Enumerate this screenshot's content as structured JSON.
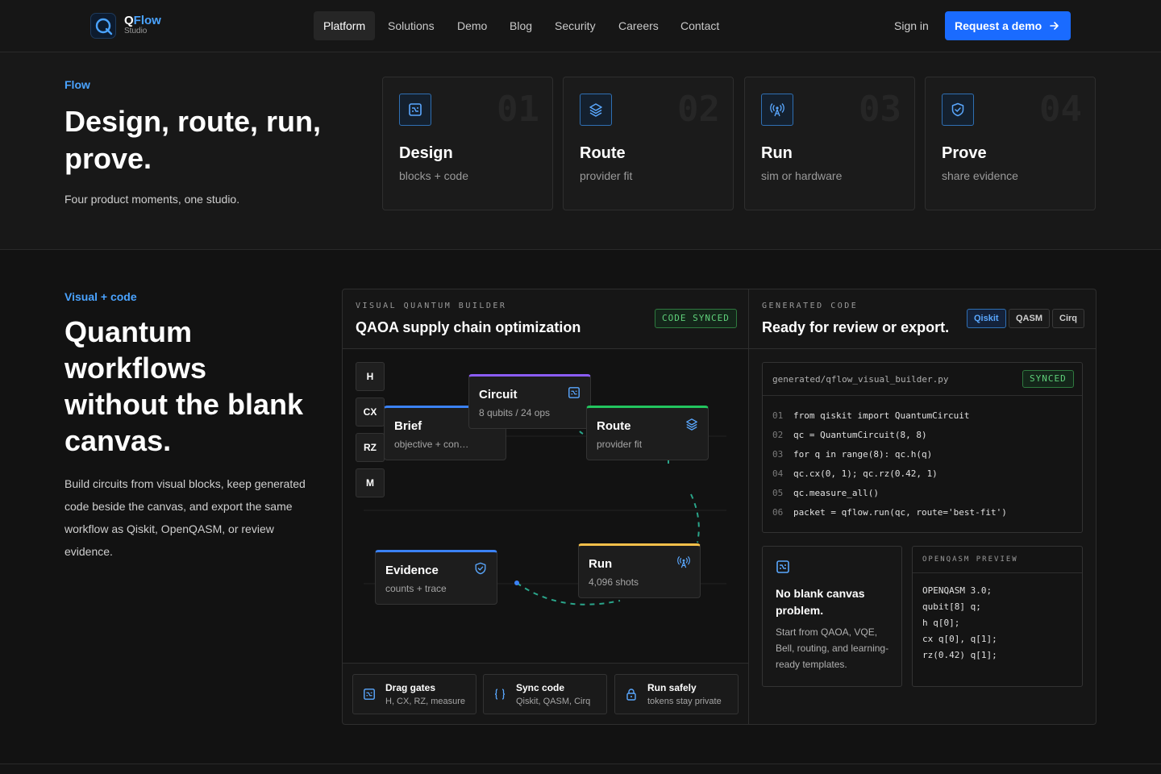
{
  "brand": {
    "name_a": "Q",
    "name_b": "Flow",
    "sub": "Studio"
  },
  "nav": {
    "items": [
      {
        "label": "Platform",
        "active": true
      },
      {
        "label": "Solutions"
      },
      {
        "label": "Demo"
      },
      {
        "label": "Blog"
      },
      {
        "label": "Security"
      },
      {
        "label": "Careers"
      },
      {
        "label": "Contact"
      }
    ],
    "signin": "Sign in",
    "cta": "Request a demo"
  },
  "flow": {
    "eyebrow": "Flow",
    "title_l1": "Design, route, run,",
    "title_l2": "prove.",
    "lead": "Four product moments, one studio.",
    "steps": [
      {
        "num": "01",
        "title": "Design",
        "sub": "blocks + code",
        "icon": "circuit-icon"
      },
      {
        "num": "02",
        "title": "Route",
        "sub": "provider fit",
        "icon": "layers-icon"
      },
      {
        "num": "03",
        "title": "Run",
        "sub": "sim or hardware",
        "icon": "antenna-icon"
      },
      {
        "num": "04",
        "title": "Prove",
        "sub": "share evidence",
        "icon": "shield-icon"
      }
    ]
  },
  "visual": {
    "eyebrow": "Visual + code",
    "title_l1": "Quantum",
    "title_l2": "workflows",
    "title_l3": "without the blank",
    "title_l4": "canvas.",
    "body": "Build circuits from visual blocks, keep generated code beside the canvas, and export the same workflow as Qiskit, OpenQASM, or review evidence."
  },
  "builder": {
    "eyebrow": "VISUAL QUANTUM BUILDER",
    "title": "QAOA supply chain optimization",
    "badge": "CODE SYNCED",
    "gates": [
      "H",
      "CX",
      "RZ",
      "M"
    ],
    "nodes": {
      "brief": {
        "title": "Brief",
        "sub": "objective + con…"
      },
      "circuit": {
        "title": "Circuit",
        "sub": "8 qubits / 24 ops"
      },
      "route": {
        "title": "Route",
        "sub": "provider fit"
      },
      "evidence": {
        "title": "Evidence",
        "sub": "counts + trace"
      },
      "run": {
        "title": "Run",
        "sub": "4,096 shots"
      }
    },
    "features": [
      {
        "title": "Drag gates",
        "sub": "H, CX, RZ, measure"
      },
      {
        "title": "Sync code",
        "sub": "Qiskit, QASM, Cirq"
      },
      {
        "title": "Run safely",
        "sub": "tokens stay private"
      }
    ]
  },
  "code": {
    "eyebrow": "GENERATED CODE",
    "title": "Ready for review or export.",
    "tabs": [
      "Qiskit",
      "QASM",
      "Cirq"
    ],
    "active_tab": "Qiskit",
    "file": "generated/qflow_visual_builder.py",
    "badge": "SYNCED",
    "lines": [
      {
        "n": "01",
        "t": "from qiskit import QuantumCircuit"
      },
      {
        "n": "02",
        "t": "qc = QuantumCircuit(8, 8)"
      },
      {
        "n": "03",
        "t": "for q in range(8): qc.h(q)"
      },
      {
        "n": "04",
        "t": "qc.cx(0, 1); qc.rz(0.42, 1)"
      },
      {
        "n": "05",
        "t": "qc.measure_all()"
      },
      {
        "n": "06",
        "t": "packet = qflow.run(qc, route='best-fit')"
      }
    ],
    "nb_title": "No blank canvas problem.",
    "nb_text": "Start from QAOA, VQE, Bell, routing, and learning-ready templates.",
    "qasm_head": "OPENQASM PREVIEW",
    "qasm_lines": [
      "OPENQASM 3.0;",
      "qubit[8] q;",
      "h q[0];",
      "cx q[0], q[1];",
      "rz(0.42) q[1];"
    ]
  },
  "colors": {
    "accent": "#1a6bff",
    "link": "#4aa3ff",
    "brief": "#3b82f6",
    "circuit": "#8b5cf6",
    "route": "#22c55e",
    "evidence": "#3b82f6",
    "run": "#f5c04a",
    "synced": "#5fd07a"
  }
}
